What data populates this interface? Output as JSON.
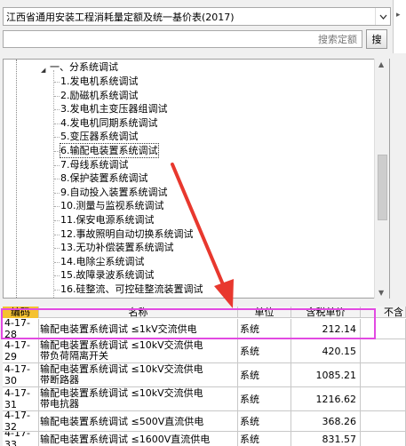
{
  "dropdown": {
    "value": "江西省通用安装工程消耗量定额及统一基价表(2017)"
  },
  "search": {
    "placeholder": "搜索定额",
    "button_label": "搜"
  },
  "tree": {
    "parent_label": "一、分系统调试",
    "items": [
      "1.发电机系统调试",
      "2.励磁机系统调试",
      "3.发电机主变压器组调试",
      "4.发电机同期系统调试",
      "5.变压器系统调试",
      "6.输配电装置系统调试",
      "7.母线系统调试",
      "8.保护装置系统调试",
      "9.自动投入装置系统调试",
      "10.测量与监视系统调试",
      "11.保安电源系统调试",
      "12.事故照明自动切换系统调试",
      "13.无功补偿装置系统调试",
      "14.电除尘系统调试",
      "15.故障录波系统调试",
      "16.硅整流、可控硅整流装置调试"
    ],
    "selected_index": 5
  },
  "table": {
    "headers": {
      "code": "编码",
      "name": "名称",
      "unit": "单位",
      "price": "含税单价",
      "extra": "不含"
    },
    "rows": [
      {
        "code": "4-17-28",
        "name_line1": "输配电装置系统调试 ≤1kV交流供电",
        "name_line2": "",
        "unit": "系统",
        "price": "212.14"
      },
      {
        "code": "4-17-29",
        "name_line1": "输配电装置系统调试 ≤10kV交流供电",
        "name_line2": "带负荷隔离开关",
        "unit": "系统",
        "price": "420.15"
      },
      {
        "code": "4-17-30",
        "name_line1": "输配电装置系统调试 ≤10kV交流供电",
        "name_line2": "带断路器",
        "unit": "系统",
        "price": "1085.21"
      },
      {
        "code": "4-17-31",
        "name_line1": "输配电装置系统调试 ≤10kV交流供电",
        "name_line2": "带电抗器",
        "unit": "系统",
        "price": "1216.62"
      },
      {
        "code": "4-17-32",
        "name_line1": "输配电装置系统调试 ≤500V直流供电",
        "name_line2": "",
        "unit": "系统",
        "price": "368.26"
      },
      {
        "code": "4-17-33",
        "name_line1": "输配电装置系统调试 ≤1600V直流供电",
        "name_line2": "",
        "unit": "系统",
        "price": "831.57"
      }
    ]
  },
  "colors": {
    "highlight": "#e24ae2",
    "arrow": "#e8382e",
    "code_header": "#f5c230"
  }
}
